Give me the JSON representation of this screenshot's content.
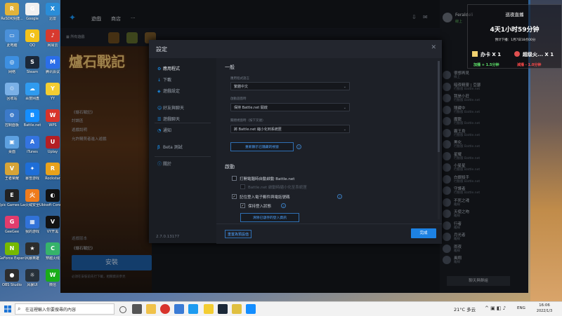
{
  "desktop": {
    "icons": [
      {
        "label": "ReSDK快捷...",
        "color": "#e2b33a",
        "glyph": "R"
      },
      {
        "label": "Google",
        "color": "#f0f0f0",
        "glyph": "G"
      },
      {
        "label": "迅雷",
        "color": "#2a8dd8",
        "glyph": "X"
      },
      {
        "label": "此电脑",
        "color": "#4a90d9",
        "glyph": "▭"
      },
      {
        "label": "QQ",
        "color": "#f3c21a",
        "glyph": "Q"
      },
      {
        "label": "网易云",
        "color": "#d73a2f",
        "glyph": "♪"
      },
      {
        "label": "网络",
        "color": "#3d8fe0",
        "glyph": "◎"
      },
      {
        "label": "Steam",
        "color": "#1b2838",
        "glyph": "S"
      },
      {
        "label": "腾讯会议",
        "color": "#2b6ee8",
        "glyph": "M"
      },
      {
        "label": "回收站",
        "color": "#7ab0e6",
        "glyph": "♲"
      },
      {
        "label": "百度网盘",
        "color": "#2f9bf0",
        "glyph": "☁"
      },
      {
        "label": "YY",
        "color": "#f3cd32",
        "glyph": "Y"
      },
      {
        "label": "控制面板",
        "color": "#3c7ac9",
        "glyph": "⚙"
      },
      {
        "label": "Battle.net",
        "color": "#148eff",
        "glyph": "B"
      },
      {
        "label": "WPS",
        "color": "#d8342c",
        "glyph": "W"
      },
      {
        "label": "桌面",
        "color": "#5da0e0",
        "glyph": "▣"
      },
      {
        "label": "iTunes",
        "color": "#3474e0",
        "glyph": "A"
      },
      {
        "label": "Uplay",
        "color": "#b31f24",
        "glyph": "U"
      },
      {
        "label": "王者荣耀",
        "color": "#d6a437",
        "glyph": "V"
      },
      {
        "label": "暴雪游戏",
        "color": "#1e6ed8",
        "glyph": "✦"
      },
      {
        "label": "Rockstar",
        "color": "#e8a21c",
        "glyph": "R"
      },
      {
        "label": "Epic Games Launcher",
        "color": "#222",
        "glyph": "E"
      },
      {
        "label": "火绒安全",
        "color": "#ef7c1d",
        "glyph": "火"
      },
      {
        "label": "Ubisoft Connect",
        "color": "#111",
        "glyph": "◐"
      },
      {
        "label": "GeeGee",
        "color": "#e23c6d",
        "glyph": "G"
      },
      {
        "label": "我的游戏",
        "color": "#3172d8",
        "glyph": "▦"
      },
      {
        "label": "VY开黑",
        "color": "#121212",
        "glyph": "V"
      },
      {
        "label": "GeForce Experience",
        "color": "#76b900",
        "glyph": "N"
      },
      {
        "label": "风暴英雄",
        "color": "#2c2c2c",
        "glyph": "★"
      },
      {
        "label": "穿越火线",
        "color": "#36b36a",
        "glyph": "C"
      },
      {
        "label": "OBS Studio",
        "color": "#2d2d2d",
        "glyph": "●"
      },
      {
        "label": "风暴UI",
        "color": "#27313a",
        "glyph": "☼"
      },
      {
        "label": "微信",
        "color": "#1aad19",
        "glyph": "W"
      }
    ]
  },
  "bnet": {
    "nav": [
      "遊戲",
      "商店",
      "···"
    ],
    "hero_title": "爐石戰記",
    "hero_lines": [
      "《爐石戰記》",
      "討論區",
      "遊戲說明",
      "允許購買者進入遊戲"
    ],
    "version_label": "遊戲版本",
    "version_value": "《爐石戰記》",
    "install_label": "安裝",
    "install_note": "必須在安裝前先行下載，相關資訊參見",
    "friends": {
      "header_name": "Feraldeli",
      "header_status": "線上",
      "items": [
        {
          "name": "很想再見",
          "status": "線上"
        },
        {
          "name": "暗夜精靈 | 亞瑟",
          "status": "行動版 Battle.net"
        },
        {
          "name": "我是小莊",
          "status": "行動版 Battle.net"
        },
        {
          "name": "隱藏中",
          "status": "行動版 Battle.net"
        },
        {
          "name": "魔龍",
          "status": "行動版 Battle.net"
        },
        {
          "name": "霸王烏",
          "status": "行動版 Battle.net"
        },
        {
          "name": "黑化",
          "status": "行動版 Battle.net"
        },
        {
          "name": "星耀",
          "status": "行動版 Battle.net"
        },
        {
          "name": "小星星",
          "status": "行動版 Battle.net"
        },
        {
          "name": "白銀殺手",
          "status": "行動版 Battle.net"
        },
        {
          "name": "守護者",
          "status": "行動版 Battle.net"
        },
        {
          "name": "不死之魂",
          "status": "離線"
        },
        {
          "name": "天使之吻",
          "status": "離線"
        },
        {
          "name": "行者",
          "status": "離線"
        },
        {
          "name": "月光者",
          "status": "離線"
        },
        {
          "name": "雨夜",
          "status": "離線"
        },
        {
          "name": "風翔",
          "status": "離線"
        }
      ],
      "new_chat": "聊天與群組"
    }
  },
  "settings": {
    "title": "設定",
    "nav": [
      {
        "label": "應用程式",
        "icon": "⚙",
        "active": true
      },
      {
        "label": "下載",
        "icon": "↓",
        "active": false
      },
      {
        "label": "遊戲設定",
        "icon": "◈",
        "active": false
      },
      {
        "label": "好友與聊天",
        "icon": "☺",
        "active": false
      },
      {
        "label": "遊戲聊天",
        "icon": "☰",
        "active": false
      },
      {
        "label": "通知",
        "icon": "◔",
        "active": false
      },
      {
        "label": "Beta 測試",
        "icon": "β",
        "active": false
      },
      {
        "label": "關於",
        "icon": "ⓘ",
        "active": false
      }
    ],
    "version": "2.7.0.13177",
    "section_general": "一般",
    "lang_label": "應用程式語言",
    "lang_value": "繁體中文",
    "startup_label": "啟動遊戲時",
    "startup_value": "保持 Battle.net 開啟",
    "close_label": "關閉視窗時（按下叉號）",
    "close_value": "將 Battle.net 縮小化到系統匣",
    "restore_button": "重新顯示已隱藏的視窗",
    "section_startup": "啟動",
    "cb_autostart": "打開電腦時自動啟動 Battle.net",
    "cb_autostart_sub": "Battle.net 啟動時縮小化至系統匣",
    "cb_remember": "記住登入電子郵件與電話號碼",
    "cb_keep_login": "保持登入狀態",
    "clear_button": "清除已儲存的登入資訊",
    "reset_button": "重置為預設值",
    "done_button": "完成"
  },
  "stream": {
    "title": "巡夜直播",
    "timer": "4天1小时59分钟",
    "next": "预计下播：1月7日18点00分",
    "left_name": "办卡 X 1",
    "right_name": "超级火... X 1",
    "left_bonus": "加播 + 1.5分钟",
    "right_bonus": "減播 - 1.0分钟"
  },
  "taskbar": {
    "search_placeholder": "在這裡輸入你要搜尋的內容",
    "weather": "21°C 多云",
    "lang": "ENG",
    "time": "16:06",
    "date": "2022/1/3"
  }
}
